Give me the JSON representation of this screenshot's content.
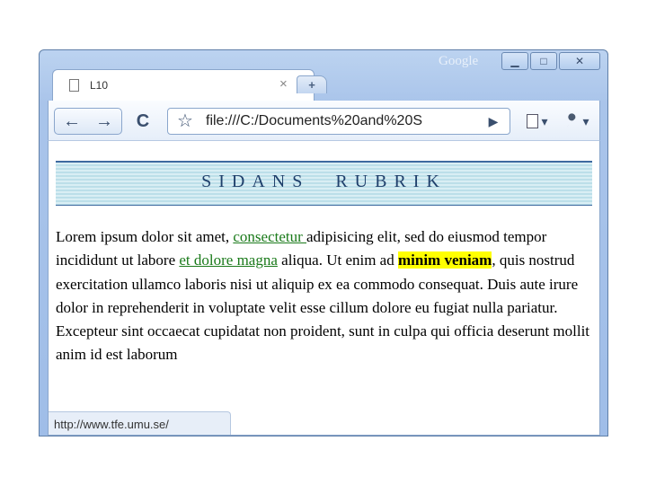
{
  "window": {
    "brand": "Google",
    "controls": {
      "minimize": "▁",
      "maximize": "□",
      "close": "✕"
    }
  },
  "tabs": [
    {
      "title": "L10",
      "close_glyph": "×"
    }
  ],
  "new_tab_glyph": "+",
  "toolbar": {
    "back_glyph": "←",
    "forward_glyph": "→",
    "reload_glyph": "C",
    "bookmark_glyph": "☆",
    "url": "file:///C:/Documents%20and%20S",
    "go_glyph": "▶",
    "page_menu_glyph": "▾",
    "wrench_menu_glyph": "▾"
  },
  "page": {
    "heading": "SIDANS RUBRIK",
    "paragraph": {
      "t1": "Lorem ipsum dolor sit amet, ",
      "link1": "consectetur ",
      "t2": "adipisicing elit, sed do eiusmod tempor incididunt ut labore ",
      "link2": "et dolore magna",
      "t3": " aliqua. Ut enim ad ",
      "highlight": "minim veniam",
      "t4": ", quis nostrud exercitation ullamco laboris nisi ut aliquip ex ea commodo consequat. Duis aute irure dolor in reprehenderit in voluptate velit esse cillum dolore eu fugiat nulla pariatur. Excepteur sint occaecat cupidatat non proident, sunt in culpa qui officia deserunt mollit anim id est laborum"
    }
  },
  "status_bar": {
    "text": "http://www.tfe.umu.se/"
  },
  "colors": {
    "link": "#1a7a1a",
    "highlight": "#ffff00",
    "heading": "#1f3f6b",
    "frame": "#a9c4ea"
  }
}
